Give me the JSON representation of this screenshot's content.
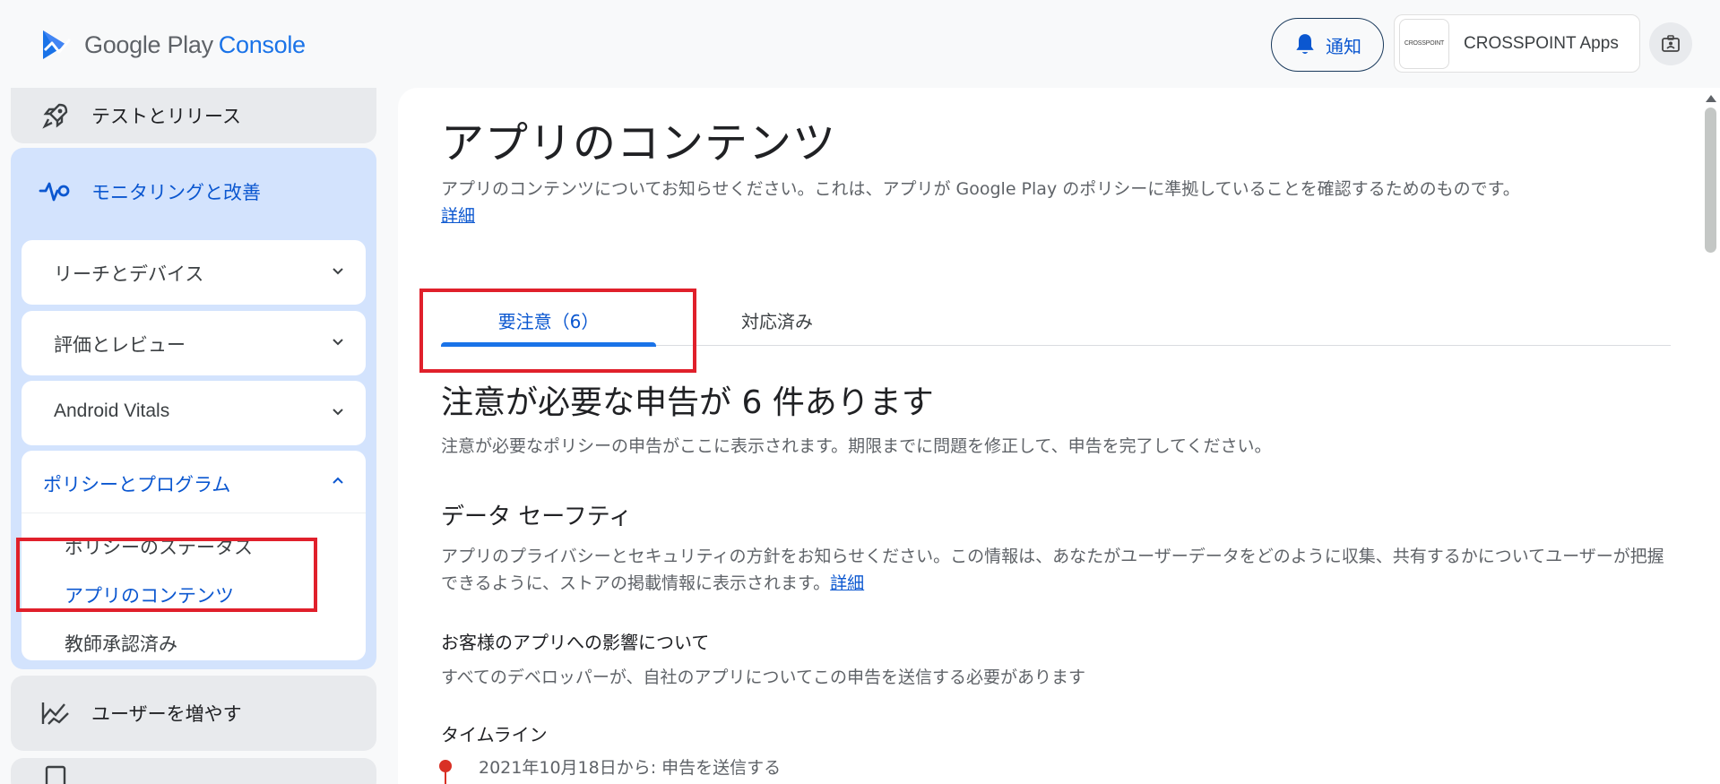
{
  "header": {
    "logo_google_play": "Google Play",
    "logo_console": "Console",
    "notification_label": "通知",
    "account_logo_text": "CROSSPOINT",
    "account_name": "CROSSPOINT Apps"
  },
  "sidebar": {
    "test_release": "テストとリリース",
    "monitoring": "モニタリングと改善",
    "reach_devices": "リーチとデバイス",
    "ratings_reviews": "評価とレビュー",
    "android_vitals": "Android Vitals",
    "policy_programs": "ポリシーとプログラム",
    "policy_status": "ポリシーのステータス",
    "app_content": "アプリのコンテンツ",
    "teacher_approved": "教師承認済み",
    "grow_users": "ユーザーを増やす"
  },
  "main": {
    "title": "アプリのコンテンツ",
    "description": "アプリのコンテンツについてお知らせください。これは、アプリが Google Play のポリシーに準拠していることを確認するためのものです。",
    "details_link": "詳細",
    "tabs": {
      "attention": "要注意（6）",
      "done": "対応済み"
    },
    "attention_heading": "注意が必要な申告が 6 件あります",
    "attention_desc": "注意が必要なポリシーの申告がここに表示されます。期限までに問題を修正して、申告を完了してください。",
    "data_safety_heading": "データ セーフティ",
    "data_safety_desc": "アプリのプライバシーとセキュリティの方針をお知らせください。この情報は、あなたがユーザーデータをどのように収集、共有するかについてユーザーが把握できるように、ストアの掲載情報に表示されます。",
    "data_safety_link": "詳細",
    "impact_heading": "お客様のアプリへの影響について",
    "impact_desc": "すべてのデベロッパーが、自社のアプリについてこの申告を送信する必要があります",
    "timeline_heading": "タイムライン",
    "timeline_item": "2021年10月18日から: 申告を送信する"
  },
  "colors": {
    "accent": "#0b57d0",
    "highlight": "#e0202b",
    "nav_selected_bg": "#d3e3fd",
    "timeline_dot": "#d93025"
  }
}
